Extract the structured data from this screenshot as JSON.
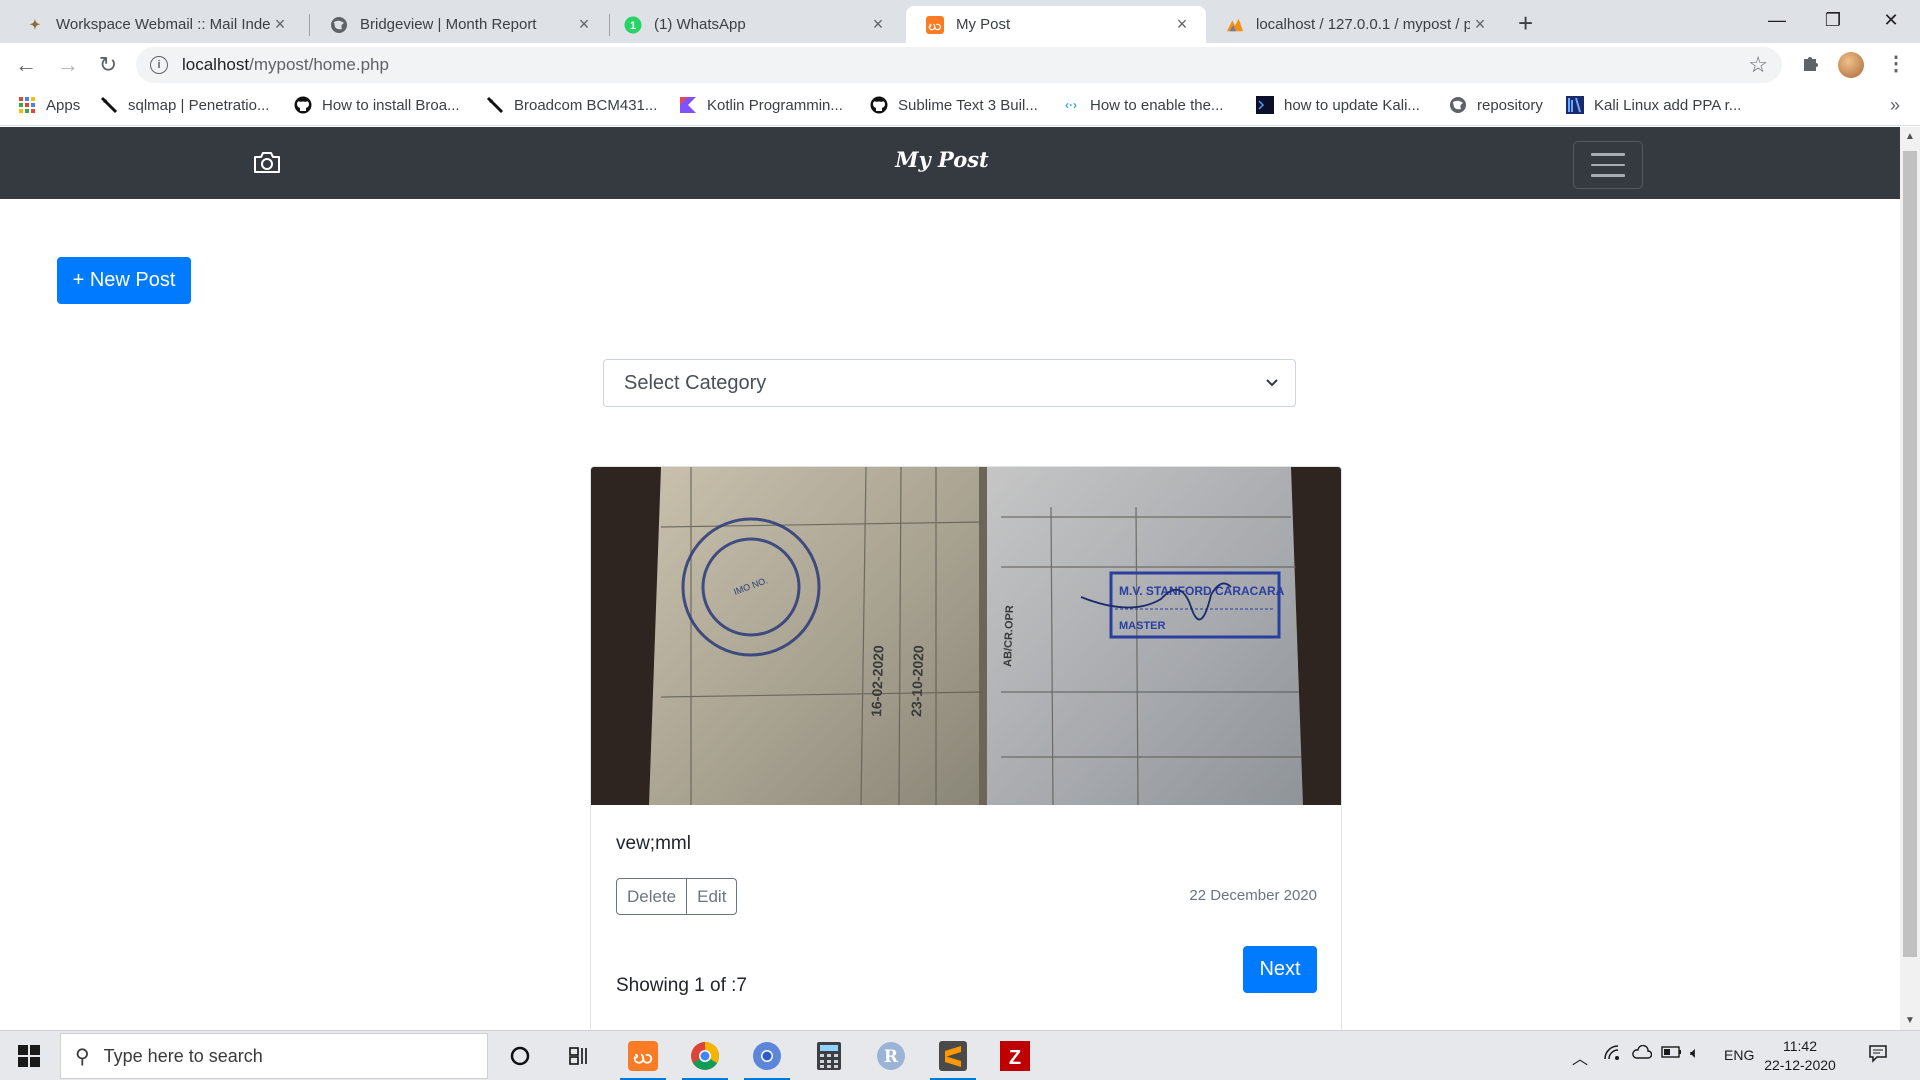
{
  "browser": {
    "tabs": [
      {
        "title": "Workspace Webmail :: Mail Index",
        "favicon": "webmail-icon",
        "active": false
      },
      {
        "title": "Bridgeview | Month Report",
        "favicon": "globe-icon",
        "active": false
      },
      {
        "title": "(1) WhatsApp",
        "favicon": "whatsapp-icon",
        "active": false
      },
      {
        "title": "My Post",
        "favicon": "xampp-icon",
        "active": true
      },
      {
        "title": "localhost / 127.0.0.1 / mypost / p",
        "favicon": "phpmyadmin-icon",
        "active": false
      }
    ],
    "url_host": "localhost",
    "url_path": "/mypost/home.php",
    "bookmarks": [
      {
        "label": "Apps",
        "icon": "apps-grid-icon"
      },
      {
        "label": "sqlmap | Penetratio...",
        "icon": "sqlmap-icon"
      },
      {
        "label": "How to install Broa...",
        "icon": "github-icon"
      },
      {
        "label": "Broadcom BCM431...",
        "icon": "sqlmap-icon"
      },
      {
        "label": "Kotlin Programmin...",
        "icon": "kotlin-icon"
      },
      {
        "label": "Sublime Text 3 Buil...",
        "icon": "github-icon"
      },
      {
        "label": "How to enable the...",
        "icon": "link-icon"
      },
      {
        "label": "how to update Kali...",
        "icon": "terminal-icon"
      },
      {
        "label": "repository",
        "icon": "globe-icon"
      },
      {
        "label": "Kali Linux add PPA r...",
        "icon": "kali-icon"
      }
    ]
  },
  "page": {
    "brand": "My Post",
    "new_post_label": "+ New Post",
    "category_select": {
      "selected": "Select Category"
    },
    "post": {
      "caption": "vew;mml",
      "delete_label": "Delete",
      "edit_label": "Edit",
      "date": "22 December 2020",
      "image_stamp_text": "M.V. STANFORD CARACARA",
      "image_stamp_role": "MASTER"
    },
    "next_label": "Next",
    "pagination_text": "Showing 1 of :7"
  },
  "taskbar": {
    "search_placeholder": "Type here to search",
    "language": "ENG",
    "time": "11:42",
    "date": "22-12-2020"
  },
  "colors": {
    "navbar": "#343a40",
    "primary": "#007bff",
    "secondary": "#6c757d"
  }
}
